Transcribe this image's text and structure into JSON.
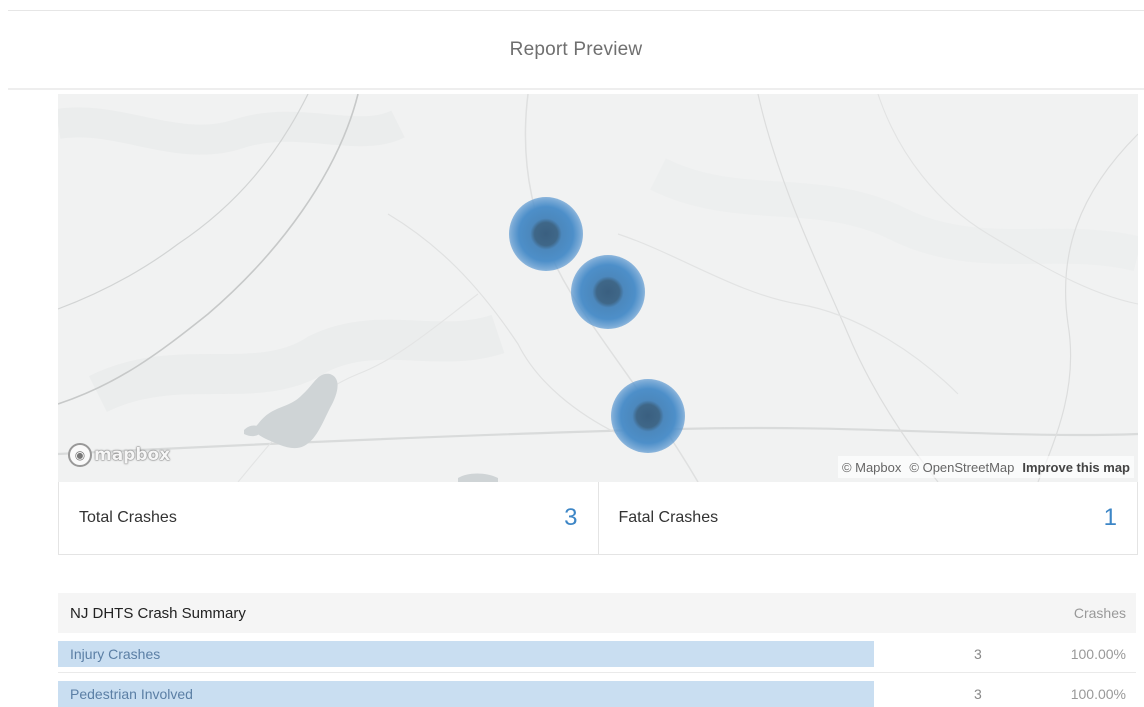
{
  "header": {
    "title": "Report Preview"
  },
  "map": {
    "logo_text": "mapbox",
    "attribution": {
      "mapbox": "© Mapbox",
      "osm": "© OpenStreetMap",
      "improve": "Improve this map"
    },
    "cluster_count": 3
  },
  "stats": {
    "total": {
      "label": "Total Crashes",
      "value": "3"
    },
    "fatal": {
      "label": "Fatal Crashes",
      "value": "1"
    }
  },
  "summary": {
    "title": "NJ DHTS Crash Summary",
    "column": "Crashes",
    "rows": [
      {
        "label": "Injury Crashes",
        "count": "3",
        "percent": "100.00%",
        "share": 1.0
      },
      {
        "label": "Pedestrian Involved",
        "count": "3",
        "percent": "100.00%",
        "share": 1.0
      }
    ]
  },
  "colors": {
    "accent": "#3d86c6",
    "bar": "#c9def1",
    "cluster": "#4d8fc9"
  }
}
